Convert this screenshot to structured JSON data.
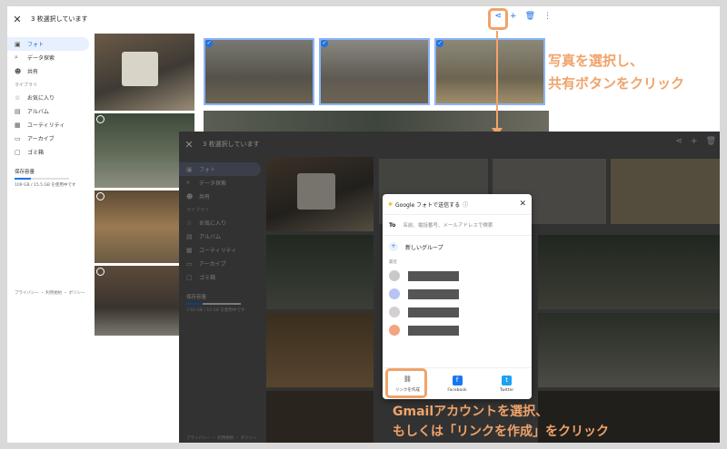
{
  "back": {
    "title": "3 枚選択しています",
    "nav": [
      {
        "label": "フォト",
        "icon": "photo-icon",
        "active": true
      },
      {
        "label": "データ探索",
        "icon": "search-icon"
      },
      {
        "label": "共有",
        "icon": "people-icon"
      }
    ],
    "library_label": "ライブラリ",
    "library": [
      {
        "label": "お気に入り",
        "icon": "star-icon"
      },
      {
        "label": "アルバム",
        "icon": "album-icon"
      },
      {
        "label": "ユーティリティ",
        "icon": "utility-icon"
      },
      {
        "label": "アーカイブ",
        "icon": "archive-icon"
      },
      {
        "label": "ゴミ箱",
        "icon": "trash-icon"
      }
    ],
    "storage_title": "保存容量",
    "storage_note": "109 GB / 15.5 GB を使用中です",
    "footer": "プライバシー ・ 利用規約 ・ ポリシー"
  },
  "front": {
    "title": "3 枚選択しています",
    "storage_note": "7.60 GB / 15 GB を使用中です",
    "footer": "プライバシー ・ 利用規約 ・ ポリシー"
  },
  "dialog": {
    "title": "Google フォトで送信する",
    "to_label": "To",
    "to_placeholder": "名前、電話番号、メールアドレスで検索",
    "group_label": "新しいグループ",
    "recent_label": "最近",
    "buttons": [
      {
        "label": "リンクを作成",
        "icon": "link-icon"
      },
      {
        "label": "Facebook",
        "icon": "facebook-icon"
      },
      {
        "label": "Twitter",
        "icon": "twitter-icon"
      }
    ]
  },
  "captions": {
    "step1_line1": "写真を選択し、",
    "step1_line2": "共有ボタンをクリック",
    "step2_line1": "Gmailアカウントを選択、",
    "step2_line2": "もしくは「リンクを作成」をクリック"
  },
  "colors": {
    "accent": "#f0a36a",
    "blue": "#1a73e8"
  }
}
